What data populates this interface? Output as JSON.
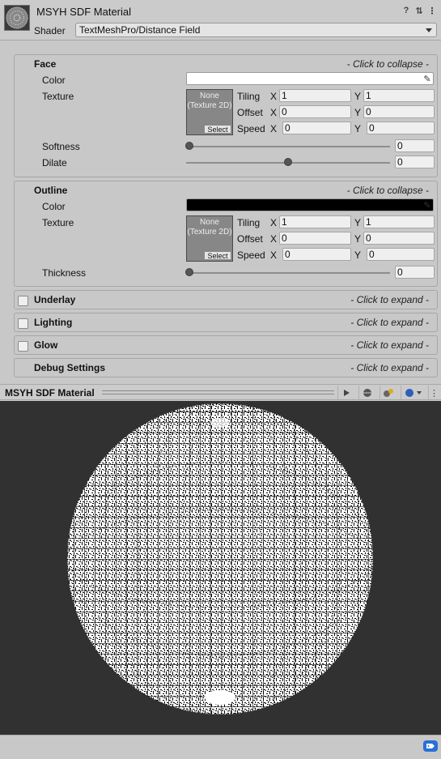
{
  "header": {
    "title": "MSYH SDF Material",
    "shader_label": "Shader",
    "shader_value": "TextMeshPro/Distance Field",
    "icons": [
      "help-icon",
      "preset-icon",
      "menu-icon"
    ]
  },
  "face": {
    "title": "Face",
    "hint": "- Click to collapse -",
    "color_label": "Color",
    "color_value": "#ffffff",
    "texture_label": "Texture",
    "texture_none": "None (Texture 2D)",
    "select_label": "Select",
    "tiling_label": "Tiling",
    "offset_label": "Offset",
    "speed_label": "Speed",
    "x_label": "X",
    "y_label": "Y",
    "tiling_x": "1",
    "tiling_y": "1",
    "offset_x": "0",
    "offset_y": "0",
    "speed_x": "0",
    "speed_y": "0",
    "softness_label": "Softness",
    "softness_value": "0",
    "dilate_label": "Dilate",
    "dilate_value": "0"
  },
  "outline": {
    "title": "Outline",
    "hint": "- Click to collapse -",
    "color_label": "Color",
    "color_value": "#000000",
    "texture_label": "Texture",
    "texture_none": "None (Texture 2D)",
    "select_label": "Select",
    "tiling_label": "Tiling",
    "offset_label": "Offset",
    "speed_label": "Speed",
    "x_label": "X",
    "y_label": "Y",
    "tiling_x": "1",
    "tiling_y": "1",
    "offset_x": "0",
    "offset_y": "0",
    "speed_x": "0",
    "speed_y": "0",
    "thickness_label": "Thickness",
    "thickness_value": "0"
  },
  "collapsed_sections": [
    {
      "title": "Underlay",
      "hint": "- Click to expand -",
      "checked": false
    },
    {
      "title": "Lighting",
      "hint": "- Click to expand -",
      "checked": false
    },
    {
      "title": "Glow",
      "hint": "- Click to expand -",
      "checked": false
    },
    {
      "title": "Debug Settings",
      "hint": "- Click to expand -"
    }
  ],
  "preview": {
    "title": "MSYH SDF Material",
    "buttons": [
      "play-icon",
      "sphere-icon",
      "lights-icon",
      "shape-dropdown-icon",
      "more-icon"
    ]
  }
}
